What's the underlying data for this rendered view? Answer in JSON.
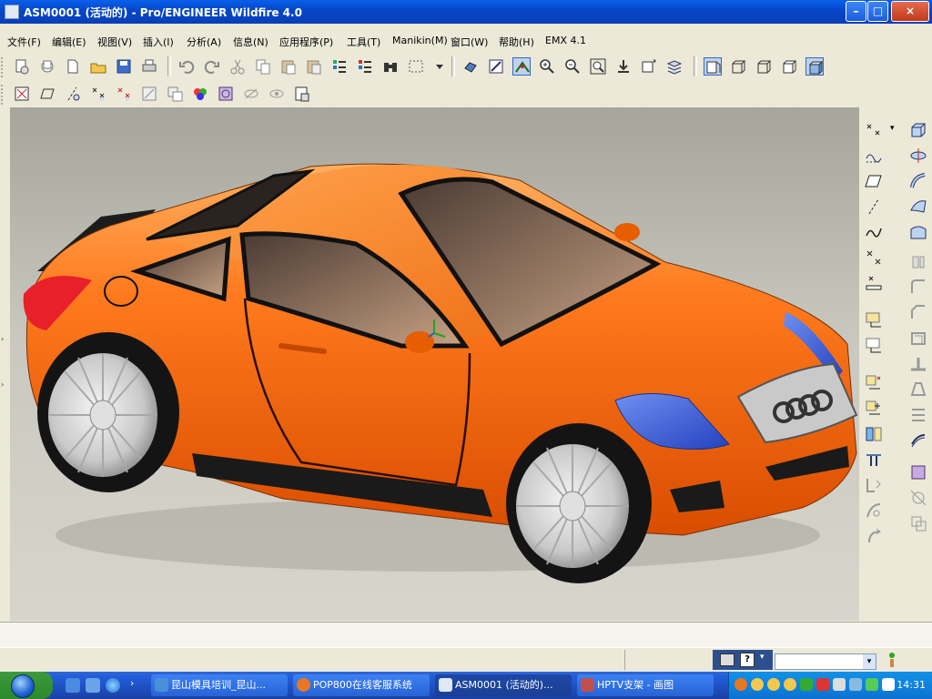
{
  "window": {
    "title": "ASM0001 (活动的) - Pro/ENGINEER Wildfire 4.0",
    "minimize": "–",
    "maximize": "□",
    "close": "×"
  },
  "menu": [
    "文件(F)",
    "编辑(E)",
    "视图(V)",
    "插入(I)",
    "分析(A)",
    "信息(N)",
    "应用程序(P)",
    "工具(T)",
    "Manikin(M)",
    "窗口(W)",
    "帮助(H)",
    "EMX 4.1"
  ],
  "toolbar_icons": {
    "row1": [
      "new-session-icon",
      "open-icon",
      "new-icon",
      "open-folder-icon",
      "save-icon",
      "print-icon",
      "undo-icon",
      "redo-icon",
      "cut-icon",
      "copy-icon",
      "paste-icon",
      "paste-special-icon",
      "regenerate-icon",
      "regen-manager-icon",
      "find-icon",
      "select-box-icon",
      "select-dropdown-icon",
      "spin-center-icon",
      "orient-mode-icon",
      "view-manager-icon",
      "zoom-in-icon",
      "zoom-out-icon",
      "refit-icon",
      "reorient-icon",
      "saved-views-icon",
      "layers-icon",
      "wireframe-icon",
      "hidden-line-icon",
      "no-hidden-icon",
      "shading-icon",
      "shading-active-icon"
    ],
    "row2": [
      "datum-planes-icon",
      "datum-axes-icon",
      "datum-points-icon",
      "coord-sys-icon",
      "annotation-icon",
      "spin-center-display-icon",
      "appearance-icon",
      "color-icon",
      "texture-icon",
      "hide-icon",
      "unhide-icon",
      "model-tree-icon"
    ]
  },
  "right_toolbar_icons": {
    "col1": [
      "datum-point-tool-icon",
      "sketch-curve-icon",
      "datum-plane-tool-icon",
      "datum-axis-tool-icon",
      "curve-tool-icon",
      "coord-point-icon",
      "offset-point-icon",
      "assemble-icon",
      "package-icon",
      "create-component-icon",
      "insert-component-icon",
      "mirror-component-icon",
      "pattern-icon",
      "cable-icon",
      "flexible-icon",
      "drag-icon"
    ],
    "col2": [
      "extrude-icon",
      "revolve-icon",
      "sweep-icon",
      "boundary-blend-icon",
      "style-icon",
      "hole-icon",
      "round-icon",
      "chamfer-icon",
      "shell-icon",
      "rib-icon",
      "draft-icon",
      "offset-icon",
      "thicken-icon",
      "merge-icon",
      "trim-icon",
      "intersect-icon"
    ]
  },
  "statusbar": {
    "filter_value": "",
    "filter_arrow": "▾"
  },
  "taskbar": {
    "tasks": [
      {
        "label": "昆山模具培训_昆山...",
        "color": "#4a90d9"
      },
      {
        "label": "POP800在线客服系统",
        "color": "#e87722"
      },
      {
        "label": "ASM0001 (活动的)...",
        "color": "#dfe8f5"
      },
      {
        "label": "HPTV支架 - 画图",
        "color": "#c0504d"
      }
    ],
    "clock": "14:31"
  },
  "colors": {
    "car_body": "#ff6a10",
    "headlight": "#3a5fd8",
    "taillight": "#e8202a",
    "titlebar": "#0546c8",
    "background_top": "#a5a59b",
    "background_bottom": "#d7d5cc"
  }
}
